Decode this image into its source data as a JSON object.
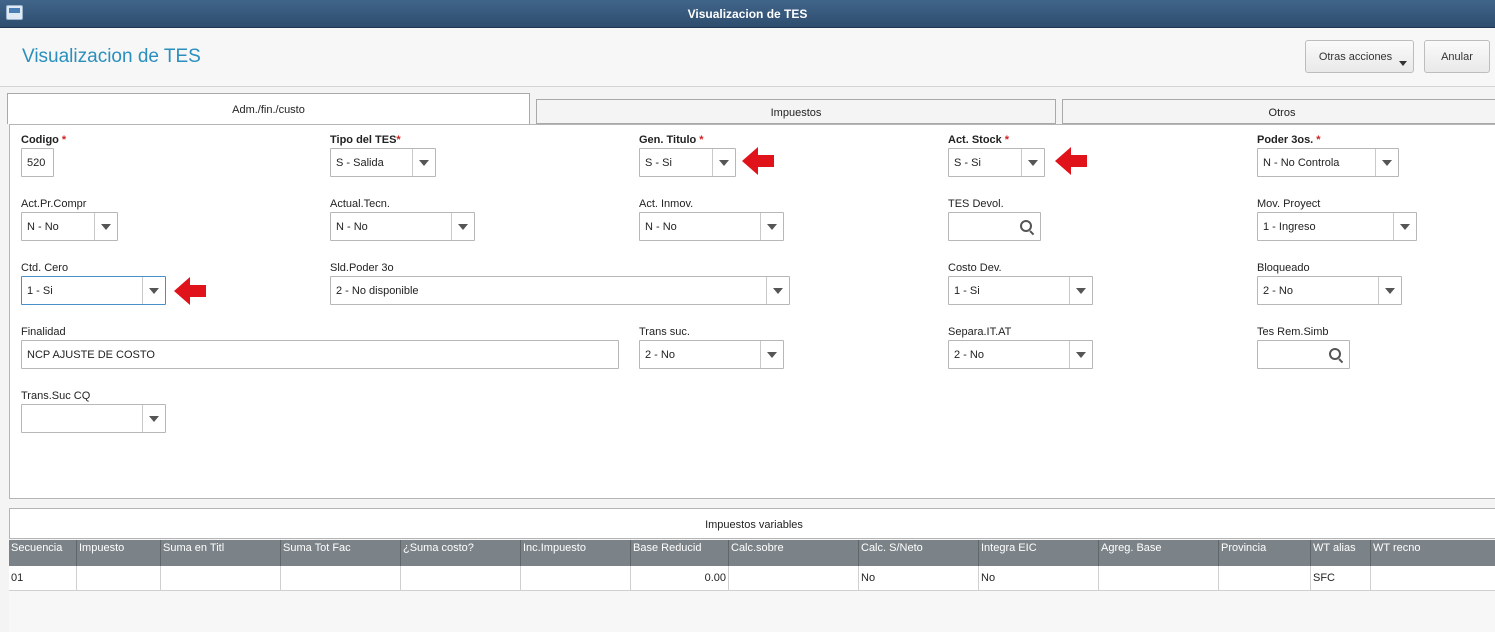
{
  "window": {
    "title": "Visualizacion de TES"
  },
  "header": {
    "page_title": "Visualizacion de TES",
    "otras_acciones_label": "Otras acciones",
    "anular_label": "Anular"
  },
  "tabs": [
    {
      "label": "Adm./fin./custo",
      "active": true
    },
    {
      "label": "Impuestos",
      "active": false
    },
    {
      "label": "Otros",
      "active": false
    }
  ],
  "form": {
    "codigo": {
      "label": "Codigo",
      "required": true,
      "value": "520"
    },
    "tipo_tes": {
      "label": "Tipo del TES",
      "required": true,
      "value": "S - Salida"
    },
    "gen_titulo": {
      "label": "Gen. Titulo",
      "required": true,
      "value": "S - Si"
    },
    "act_stock": {
      "label": "Act. Stock",
      "required": true,
      "value": "S - Si"
    },
    "poder_3os": {
      "label": "Poder 3os.",
      "required": true,
      "value": "N - No Controla"
    },
    "act_pr_compr": {
      "label": "Act.Pr.Compr",
      "value": "N - No"
    },
    "actual_tecn": {
      "label": "Actual.Tecn.",
      "value": "N - No"
    },
    "act_inmov": {
      "label": "Act. Inmov.",
      "value": "N - No"
    },
    "tes_devol": {
      "label": "TES Devol.",
      "value": ""
    },
    "mov_proyect": {
      "label": "Mov. Proyect",
      "value": "1 - Ingreso"
    },
    "ctd_cero": {
      "label": "Ctd. Cero",
      "value": "1 - Si"
    },
    "sld_poder_3o": {
      "label": "Sld.Poder 3o",
      "value": "2 - No disponible"
    },
    "costo_dev": {
      "label": "Costo Dev.",
      "value": "1 - Si"
    },
    "bloqueado": {
      "label": "Bloqueado",
      "value": "2 - No"
    },
    "finalidad": {
      "label": "Finalidad",
      "value": "NCP AJUSTE DE COSTO"
    },
    "trans_suc": {
      "label": "Trans suc.",
      "value": "2 - No"
    },
    "separa_it_at": {
      "label": "Separa.IT.AT",
      "value": "2 - No"
    },
    "tes_rem_simb": {
      "label": "Tes Rem.Simb",
      "value": ""
    },
    "trans_suc_cq": {
      "label": "Trans.Suc CQ",
      "value": ""
    }
  },
  "grid": {
    "title": "Impuestos variables",
    "columns": [
      "Secuencia",
      "Impuesto",
      "Suma en Titl",
      "Suma Tot Fac",
      "¿Suma costo?",
      "Inc.Impuesto",
      "Base Reducid",
      "Calc.sobre",
      "Calc. S/Neto",
      "Integra EIC",
      "Agreg. Base",
      "Provincia",
      "WT alias",
      "WT recno"
    ],
    "rows": [
      [
        "01",
        "",
        "",
        "",
        "",
        "",
        "0.00",
        "",
        "No",
        "No",
        "",
        "",
        "SFC",
        ""
      ]
    ]
  },
  "colors": {
    "title_bar": "#2e4d6f",
    "page_title": "#2a8fbd",
    "required_mark": "#d42020",
    "arrow": "#e0131b",
    "grid_header": "#7b8388"
  }
}
